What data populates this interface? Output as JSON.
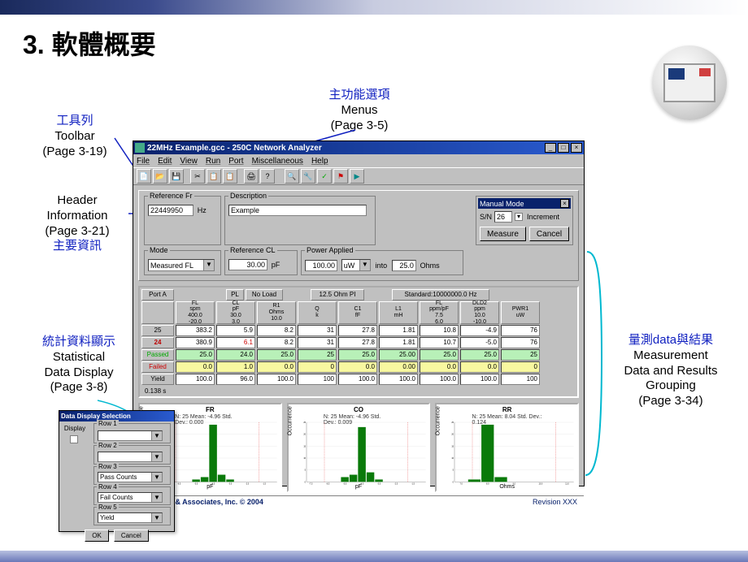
{
  "page": {
    "title": "3. 軟體概要"
  },
  "annotations": {
    "toolbar": {
      "ch": "工具列",
      "en": "Toolbar",
      "page": "(Page 3-19)"
    },
    "menus": {
      "ch": "主功能選項",
      "en": "Menus",
      "page": "(Page 3-5)"
    },
    "header": {
      "ch": "主要資訊",
      "en_line1": "Header",
      "en_line2": "Information",
      "page": "(Page 3-21)"
    },
    "stats": {
      "ch": "統計資料顯示",
      "en_line1": "Statistical",
      "en_line2": "Data Display",
      "page": "(Page 3-8)"
    },
    "results": {
      "ch": "量測data與結果",
      "en_line1": "Measurement",
      "en_line2": "Data and Results",
      "en_line3": "Grouping",
      "page": "(Page 3-34)"
    }
  },
  "app": {
    "title": "22MHz Example.gcc - 250C Network Analyzer",
    "menubar": [
      "File",
      "Edit",
      "View",
      "Run",
      "Port",
      "Miscellaneous",
      "Help"
    ],
    "header": {
      "ref_freq_legend": "Reference Fr",
      "ref_freq_value": "22449950",
      "ref_freq_unit": "Hz",
      "desc_legend": "Description",
      "desc_value": "Example",
      "mode_legend": "Mode",
      "mode_value": "Measured FL",
      "refcl_legend": "Reference CL",
      "refcl_value": "30.00",
      "refcl_unit": "pF",
      "power_legend": "Power Applied",
      "power_value": "100.00",
      "power_unit_sel": "uW",
      "into_label": "into",
      "into_value": "25.0",
      "into_unit": "Ohms",
      "manual_title": "Manual Mode",
      "sn_label": "S/N",
      "sn_value": "26",
      "increment_label": "Increment",
      "measure_btn": "Measure",
      "cancel_btn": "Cancel"
    },
    "grid": {
      "time_label": "0.138 s",
      "tabs": {
        "portA": "Port A",
        "pl": "PL",
        "noload": "No Load",
        "ohm": "12.5 Ohm PI",
        "std": "Standard:10000000.0 Hz"
      },
      "cols": [
        {
          "h1": "FL",
          "h2": "spm",
          "h3": "400.0",
          "h4": "-20.0"
        },
        {
          "h1": "CL",
          "h2": "pF",
          "h3": "30.0",
          "h4": "3.0"
        },
        {
          "h1": "R1",
          "h2": "Ohms",
          "h3": "10.0",
          "h4": ""
        },
        {
          "h1": "Q",
          "h2": "k",
          "h3": "",
          "h4": ""
        },
        {
          "h1": "C1",
          "h2": "fF",
          "h3": "",
          "h4": ""
        },
        {
          "h1": "L1",
          "h2": "mH",
          "h3": "",
          "h4": ""
        },
        {
          "h1": "FL",
          "h2": "ppm/pF",
          "h3": "7.5",
          "h4": "6.0"
        },
        {
          "h1": "DLD2",
          "h2": "ppm",
          "h3": "10.0",
          "h4": "-10.0"
        },
        {
          "h1": "PWR1",
          "h2": "uW",
          "h3": "",
          "h4": ""
        }
      ],
      "rows": [
        {
          "label": "25",
          "cells": [
            "383.2",
            "5.9",
            "8.2",
            "31",
            "27.8",
            "1.81",
            "10.8",
            "-4.9",
            "76"
          ],
          "cls": "norm"
        },
        {
          "label": "24",
          "cells": [
            "380.9",
            "6.1",
            "8.2",
            "31",
            "27.8",
            "1.81",
            "10.7",
            "-5.0",
            "76"
          ],
          "cls": "bold"
        },
        {
          "label": "Passed",
          "cells": [
            "25.0",
            "24.0",
            "25.0",
            "25",
            "25.0",
            "25.00",
            "25.0",
            "25.0",
            "25"
          ],
          "cls": "green"
        },
        {
          "label": "Failed",
          "cells": [
            "0.0",
            "1.0",
            "0.0",
            "0",
            "0.0",
            "0.00",
            "0.0",
            "0.0",
            "0"
          ],
          "cls": "yellow"
        },
        {
          "label": "Yield",
          "cells": [
            "100.0",
            "96.0",
            "100.0",
            "100",
            "100.0",
            "100.0",
            "100.0",
            "100.0",
            "100"
          ],
          "cls": "norm"
        }
      ]
    },
    "footer_left": "Saunders & Associates, Inc. © 2004",
    "footer_right": "Revision XXX"
  },
  "chart_data": [
    {
      "type": "bar",
      "title": "FR",
      "subtitle": "N: 25   Mean: -4.96   Std. Dev.: 0.000",
      "xlabel": "pF",
      "ylabel": "Occurrence",
      "categories": [
        "-7.5",
        "-7.0",
        "-6.5",
        "-6.0",
        "-5.5",
        "-5.0",
        "-4.5",
        "-4.0",
        "-3.5",
        "-3.0",
        "-2.5",
        "-2.0",
        "-1.5",
        "-1.0"
      ],
      "values": [
        0,
        0,
        0,
        0,
        1,
        2,
        24,
        3,
        1,
        0,
        0,
        0,
        0,
        0
      ],
      "ylim": [
        0,
        25
      ],
      "yticks": [
        0,
        5,
        10,
        15,
        20,
        25
      ]
    },
    {
      "type": "bar",
      "title": "CO",
      "subtitle": "N: 25   Mean: -4.96   Std. Dev.: 0.009",
      "xlabel": "pF",
      "ylabel": "Occurrence",
      "categories": [
        "-7.5",
        "-7.0",
        "-6.5",
        "-6.0",
        "-5.5",
        "-5.0",
        "-4.5",
        "-4.0",
        "-3.5",
        "-3.0",
        "-2.5",
        "-2.0",
        "-1.5",
        "-1.0"
      ],
      "values": [
        0,
        0,
        0,
        0,
        2,
        3,
        23,
        4,
        1,
        0,
        0,
        0,
        0,
        0
      ],
      "ylim": [
        0,
        25
      ],
      "yticks": [
        0,
        5,
        10,
        15,
        20,
        25
      ]
    },
    {
      "type": "bar",
      "title": "RR",
      "subtitle": "N: 25   Mean: 8.04   Std. Dev.: 0.124",
      "xlabel": "Ohms",
      "ylabel": "Occurrence",
      "categories": [
        "7.0",
        "7.5",
        "8.0",
        "8.5",
        "9.0",
        "9.5",
        "10.0",
        "10.5",
        "11.0"
      ],
      "values": [
        0,
        1,
        24,
        2,
        0,
        0,
        0,
        0,
        0
      ],
      "ylim": [
        0,
        25
      ],
      "yticks": [
        0,
        5,
        10,
        15,
        20,
        25
      ]
    }
  ],
  "dialog": {
    "title": "Data Display Selection",
    "display_label": "Display",
    "rows": [
      {
        "legend": "Row 1",
        "value": ""
      },
      {
        "legend": "Row 2",
        "value": ""
      },
      {
        "legend": "Row 3",
        "value": "Pass Counts"
      },
      {
        "legend": "Row 4",
        "value": "Fail Counts"
      },
      {
        "legend": "Row 5",
        "value": "Yield"
      }
    ],
    "ok": "OK",
    "cancel": "Cancel"
  }
}
